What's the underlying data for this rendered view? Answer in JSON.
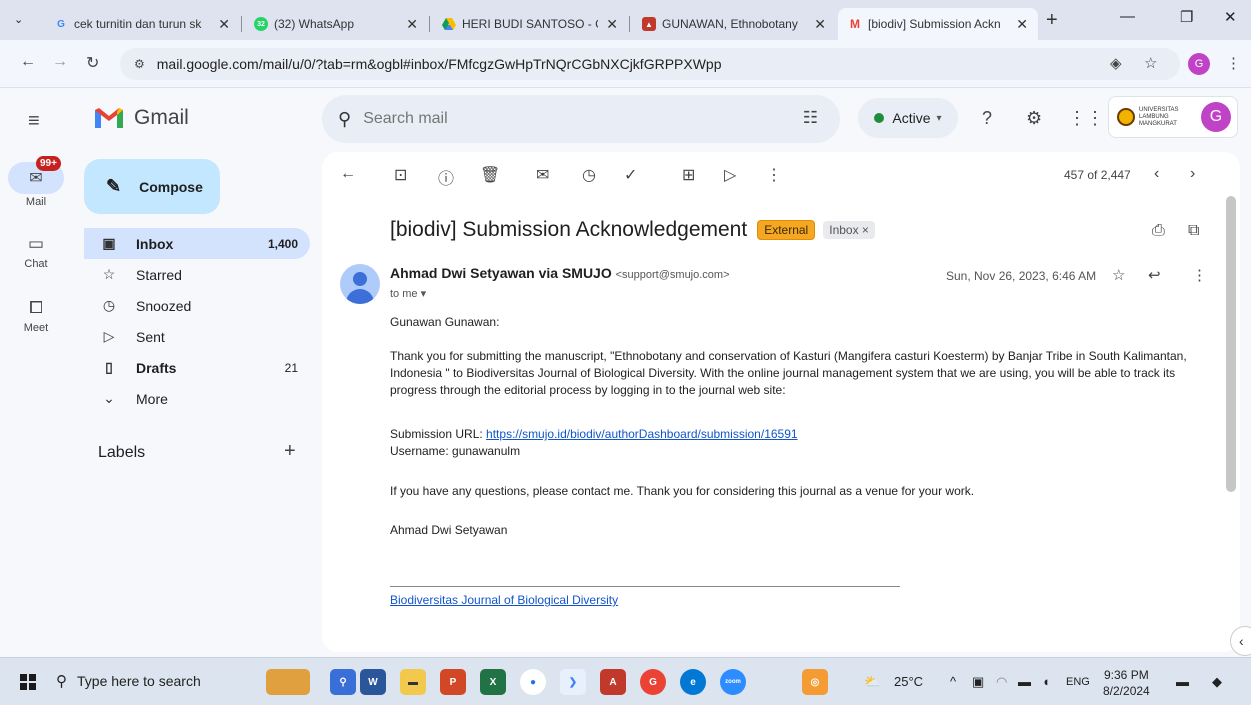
{
  "browser": {
    "tabs": [
      {
        "title": "cek turnitin dan turun sk",
        "favicon": "google-g-icon"
      },
      {
        "title": "(32) WhatsApp",
        "favicon": "whatsapp-icon"
      },
      {
        "title": "HERI BUDI SANTOSO - G",
        "favicon": "google-drive-icon"
      },
      {
        "title": "GUNAWAN, Ethnobotany",
        "favicon": "journal-icon"
      },
      {
        "title": "[biodiv] Submission Ackn",
        "favicon": "gmail-icon"
      }
    ],
    "whatsapp_count": "32",
    "url": "mail.google.com/mail/u/0/?tab=rm&ogbl#inbox/FMfcgzGwHpTrNQrCGbNXCjkfGRPPXWpp",
    "profile_initial": "G"
  },
  "gmail": {
    "app_name": "Gmail",
    "search_placeholder": "Search mail",
    "status": "Active",
    "account_org": "UNIVERSITAS LAMBUNG MANGKURAT",
    "account_initial": "G"
  },
  "rail": {
    "mail_label": "Mail",
    "mail_badge": "99+",
    "chat_label": "Chat",
    "meet_label": "Meet"
  },
  "sidebar": {
    "compose_label": "Compose",
    "items": [
      {
        "label": "Inbox",
        "count": "1,400",
        "icon": "inbox-icon"
      },
      {
        "label": "Starred",
        "count": "",
        "icon": "star-icon"
      },
      {
        "label": "Snoozed",
        "count": "",
        "icon": "clock-icon"
      },
      {
        "label": "Sent",
        "count": "",
        "icon": "send-icon"
      },
      {
        "label": "Drafts",
        "count": "21",
        "icon": "draft-icon"
      },
      {
        "label": "More",
        "count": "",
        "icon": "chevron-down-icon"
      }
    ],
    "labels_heading": "Labels"
  },
  "message": {
    "pager": "457 of 2,447",
    "subject": "[biodiv] Submission Acknowledgement",
    "tag_external": "External",
    "tag_inbox": "Inbox ×",
    "sender_name": "Ahmad Dwi Setyawan via SMUJO",
    "sender_email": "<support@smujo.com>",
    "to": "to me ▾",
    "date": "Sun, Nov 26, 2023, 6:46 AM",
    "greeting": "Gunawan Gunawan:",
    "para1": "Thank you for submitting the manuscript, \"Ethnobotany and conservation of Kasturi (Mangifera casturi Koesterm) by Banjar Tribe in South Kalimantan, Indonesia \" to Biodiversitas Journal of Biological Diversity. With the online journal management system that we are using, you will be able to track its progress through the editorial process by logging in to the journal web site:",
    "url_label": "Submission URL:",
    "url": "https://smujo.id/biodiv/authorDashboard/submission/16591",
    "username_line": "Username: gunawanulm",
    "para2": "If you have any questions, please contact me. Thank you for considering this journal as a venue for your work.",
    "signature": "Ahmad Dwi Setyawan",
    "footer_link": "Biodiversitas Journal of Biological Diversity"
  },
  "taskbar": {
    "search_placeholder": "Type here to search",
    "temperature": "25°C",
    "language": "ENG",
    "time": "9:36 PM",
    "date": "8/2/2024"
  }
}
